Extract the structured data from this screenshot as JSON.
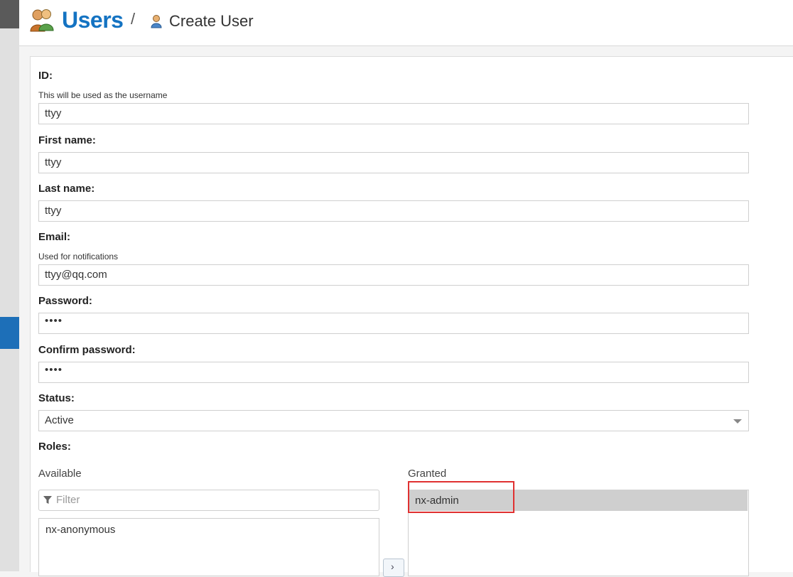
{
  "header": {
    "title": "Users",
    "separator": "/",
    "subtitle": "Create User"
  },
  "form": {
    "id": {
      "label": "ID:",
      "help": "This will be used as the username",
      "value": "ttyy"
    },
    "first_name": {
      "label": "First name:",
      "value": "ttyy"
    },
    "last_name": {
      "label": "Last name:",
      "value": "ttyy"
    },
    "email": {
      "label": "Email:",
      "help": "Used for notifications",
      "value": "ttyy@qq.com"
    },
    "password": {
      "label": "Password:",
      "value": "••••"
    },
    "confirm_password": {
      "label": "Confirm password:",
      "value": "••••"
    },
    "status": {
      "label": "Status:",
      "value": "Active"
    },
    "roles": {
      "label": "Roles:",
      "available_label": "Available",
      "granted_label": "Granted",
      "filter_placeholder": "Filter",
      "available": [
        "nx-anonymous"
      ],
      "granted": [
        "nx-admin"
      ],
      "move_right_label": "›"
    }
  },
  "colors": {
    "brand": "#1473c2",
    "sidebar_active": "#1d6fb8",
    "highlight": "#e03131",
    "selected_row": "#cfcfcf"
  }
}
